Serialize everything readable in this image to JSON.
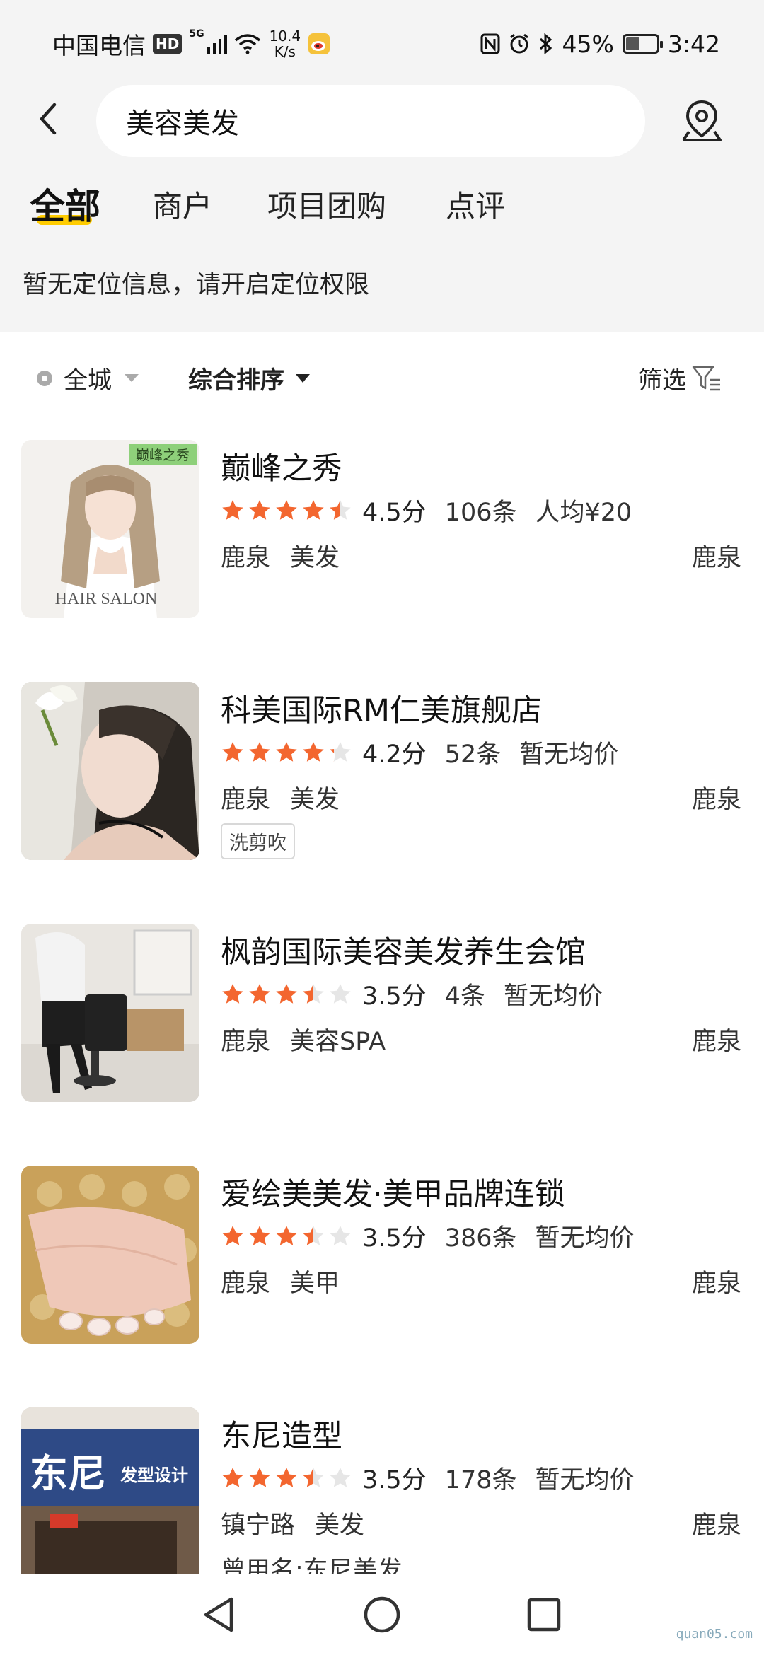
{
  "status_bar": {
    "carrier": "中国电信",
    "hd": "HD",
    "signal": "5G",
    "net_speed_value": "10.4",
    "net_speed_unit": "K/s",
    "battery": "45%",
    "battery_level": 0.45,
    "time": "3:42"
  },
  "search": {
    "query": "美容美发"
  },
  "tabs": [
    {
      "label": "全部",
      "active": true
    },
    {
      "label": "商户"
    },
    {
      "label": "项目团购"
    },
    {
      "label": "点评"
    }
  ],
  "location_hint": "暂无定位信息，请开启定位权限",
  "filters": {
    "city": "全城",
    "sort": "综合排序",
    "screen": "筛选"
  },
  "colors": {
    "accent": "#ffcc00",
    "star": "#f3662f",
    "star_empty": "#e6e6e6"
  },
  "shops": [
    {
      "name": "巅峰之秀",
      "rating": 4.5,
      "score": "4.5分",
      "count": "106条",
      "price": "人均¥20",
      "area": "鹿泉",
      "category": "美发",
      "right": "鹿泉",
      "thumb_badge": "巅峰之秀",
      "thumb_caption": "HAIR SALON"
    },
    {
      "name": "科美国际RM仁美旗舰店",
      "rating": 4.2,
      "score": "4.2分",
      "count": "52条",
      "price": "暂无均价",
      "area": "鹿泉",
      "category": "美发",
      "right": "鹿泉",
      "tag": "洗剪吹"
    },
    {
      "name": "枫韵国际美容美发养生会馆",
      "rating": 3.5,
      "score": "3.5分",
      "count": "4条",
      "price": "暂无均价",
      "area": "鹿泉",
      "category": "美容SPA",
      "right": "鹿泉"
    },
    {
      "name": "爱绘美美发·美甲品牌连锁",
      "rating": 3.5,
      "score": "3.5分",
      "count": "386条",
      "price": "暂无均价",
      "area": "鹿泉",
      "category": "美甲",
      "right": "鹿泉"
    },
    {
      "name": "东尼造型",
      "rating": 3.5,
      "score": "3.5分",
      "count": "178条",
      "price": "暂无均价",
      "area": "镇宁路",
      "category": "美发",
      "right": "鹿泉",
      "former_name": "曾用名:东尼美发",
      "thumb_sign_main": "东尼",
      "thumb_sign_sub": "发型设计"
    }
  ],
  "watermark": "quan05.com"
}
